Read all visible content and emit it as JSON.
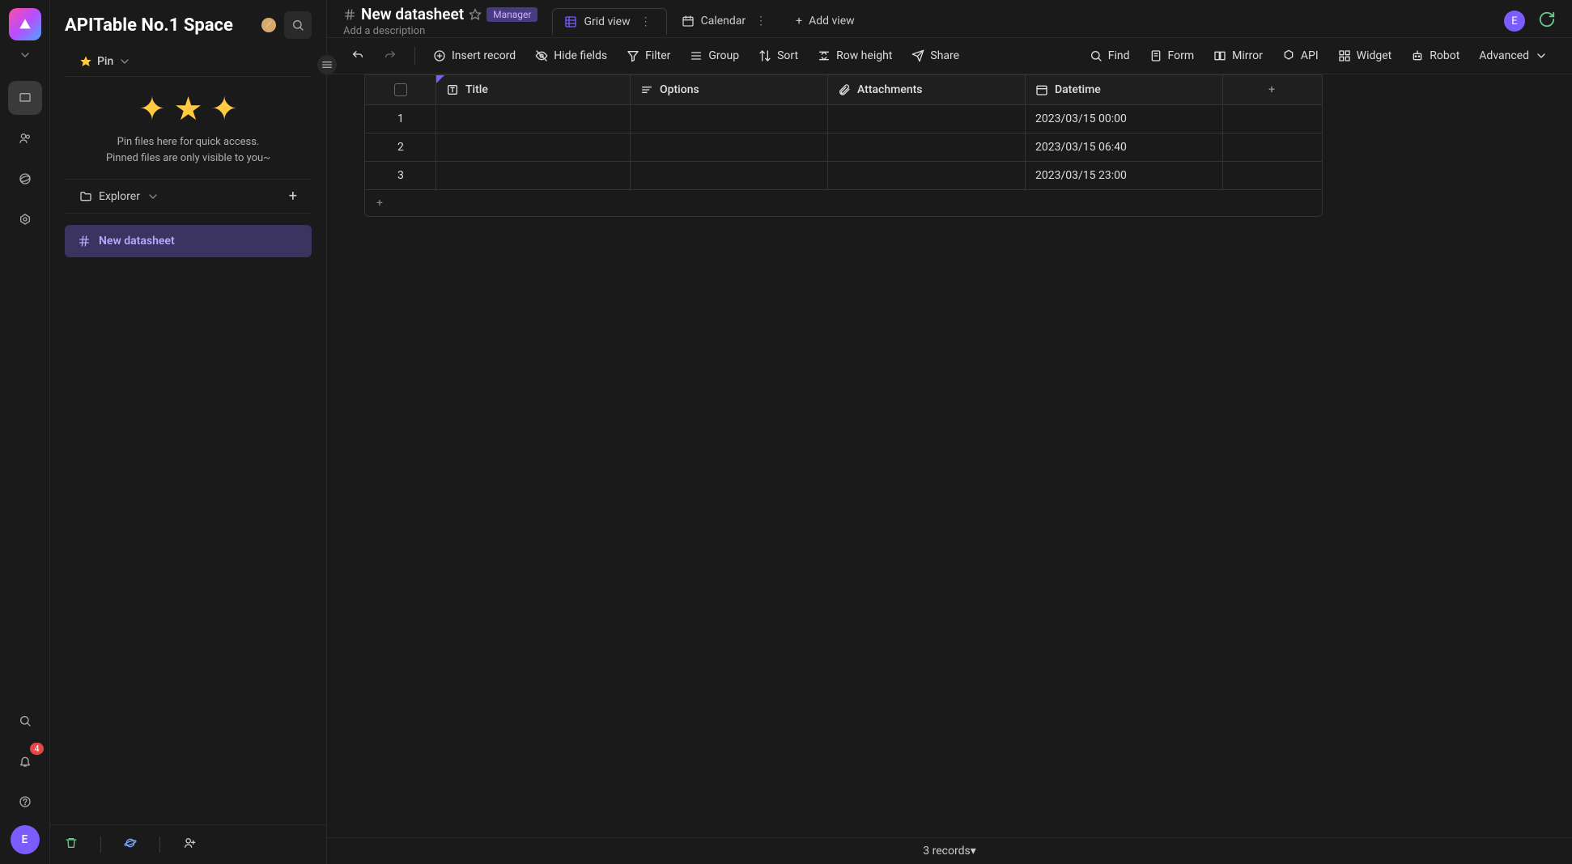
{
  "workspace": {
    "title": "APITable No.1 Space",
    "avatar_letter": "E",
    "notification_count": "4"
  },
  "sidebar": {
    "pin_label": "Pin",
    "pin_hint_line1": "Pin files here for quick access.",
    "pin_hint_line2": "Pinned files are only visible to you~",
    "explorer_label": "Explorer",
    "active_file": "New datasheet"
  },
  "datasheet": {
    "name": "New datasheet",
    "role_tag": "Manager",
    "description_placeholder": "Add a description"
  },
  "views": {
    "grid": "Grid view",
    "calendar": "Calendar",
    "add": "Add view"
  },
  "toolbar": {
    "insert_record": "Insert record",
    "hide_fields": "Hide fields",
    "filter": "Filter",
    "group": "Group",
    "sort": "Sort",
    "row_height": "Row height",
    "share": "Share",
    "find": "Find",
    "form": "Form",
    "mirror": "Mirror",
    "api": "API",
    "widget": "Widget",
    "robot": "Robot",
    "advanced": "Advanced"
  },
  "columns": {
    "title": "Title",
    "options": "Options",
    "attachments": "Attachments",
    "datetime": "Datetime"
  },
  "rows": [
    {
      "num": "1",
      "title": "",
      "options": "",
      "attachments": "",
      "datetime": "2023/03/15 00:00"
    },
    {
      "num": "2",
      "title": "",
      "options": "",
      "attachments": "",
      "datetime": "2023/03/15 06:40"
    },
    {
      "num": "3",
      "title": "",
      "options": "",
      "attachments": "",
      "datetime": "2023/03/15 23:00"
    }
  ],
  "status": {
    "records": "3 records"
  }
}
